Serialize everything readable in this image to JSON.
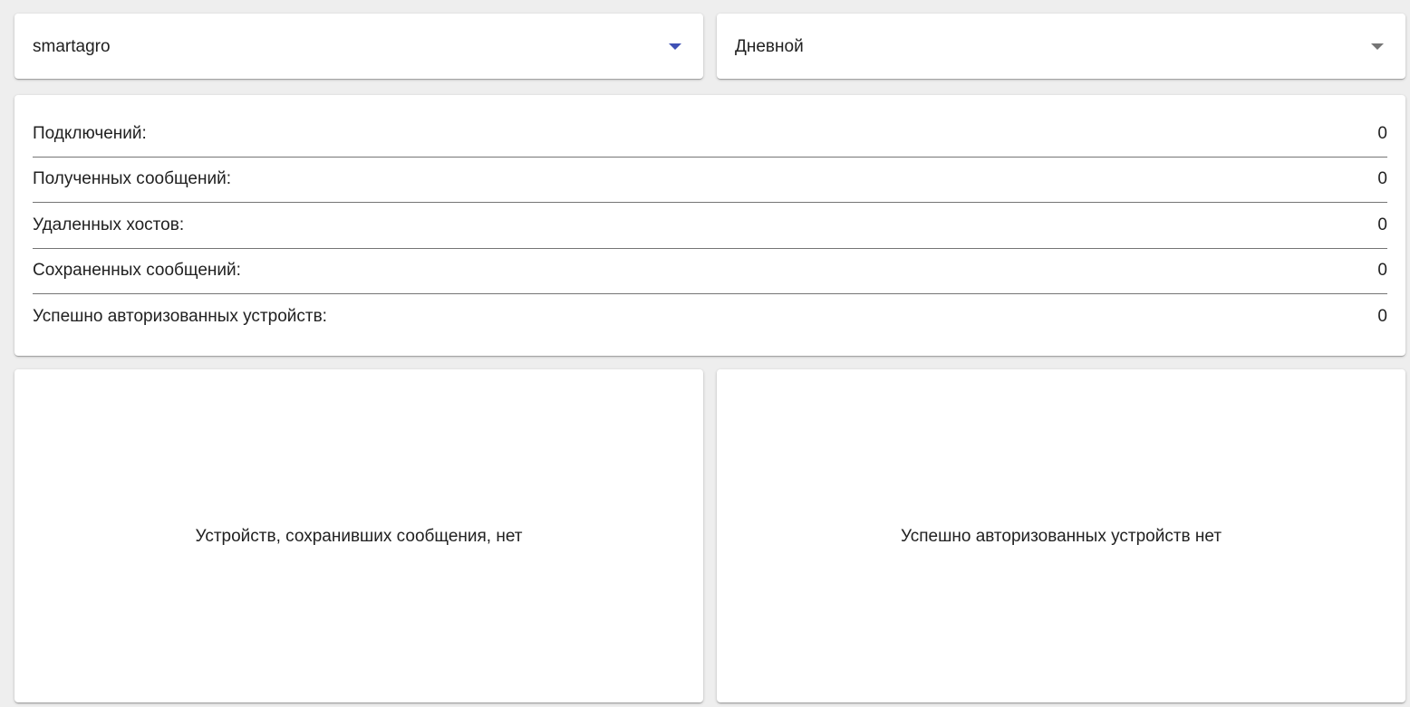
{
  "filters": {
    "tenant": {
      "value": "smartagro",
      "caret_color": "#3f51b5"
    },
    "period": {
      "value": "Дневной",
      "caret_color": "#757575"
    }
  },
  "stats": [
    {
      "label": "Подключений:",
      "value": "0"
    },
    {
      "label": "Полученных сообщений:",
      "value": "0"
    },
    {
      "label": "Удаленных хостов:",
      "value": "0"
    },
    {
      "label": "Сохраненных сообщений:",
      "value": "0"
    },
    {
      "label": "Успешно авторизованных устройств:",
      "value": "0"
    }
  ],
  "panels": {
    "saved_devices_empty": "Устройств, сохранивших сообщения, нет",
    "authorized_devices_empty": "Успешно авторизованных устройств нет"
  }
}
